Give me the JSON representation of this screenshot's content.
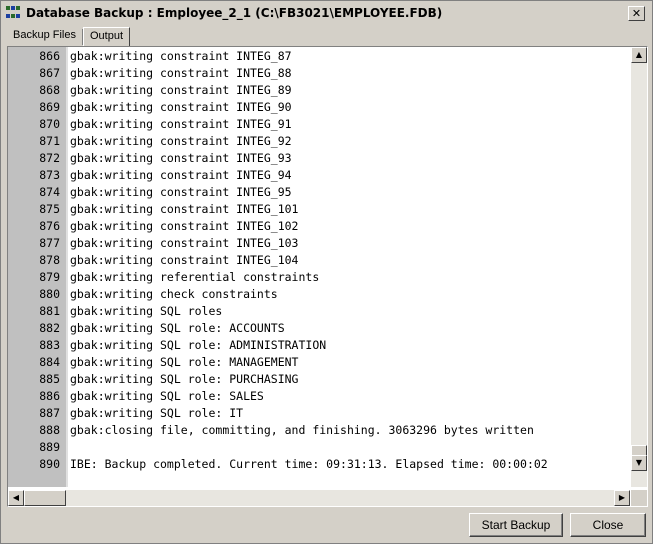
{
  "window": {
    "title": "Database Backup : Employee_2_1 (C:\\FB3021\\EMPLOYEE.FDB)",
    "close_glyph": "✕"
  },
  "tabs": [
    {
      "label": "Backup Files",
      "active": false
    },
    {
      "label": "Output",
      "active": true
    }
  ],
  "output": {
    "lines": [
      {
        "num": "866",
        "text": "gbak:writing constraint INTEG_87"
      },
      {
        "num": "867",
        "text": "gbak:writing constraint INTEG_88"
      },
      {
        "num": "868",
        "text": "gbak:writing constraint INTEG_89"
      },
      {
        "num": "869",
        "text": "gbak:writing constraint INTEG_90"
      },
      {
        "num": "870",
        "text": "gbak:writing constraint INTEG_91"
      },
      {
        "num": "871",
        "text": "gbak:writing constraint INTEG_92"
      },
      {
        "num": "872",
        "text": "gbak:writing constraint INTEG_93"
      },
      {
        "num": "873",
        "text": "gbak:writing constraint INTEG_94"
      },
      {
        "num": "874",
        "text": "gbak:writing constraint INTEG_95"
      },
      {
        "num": "875",
        "text": "gbak:writing constraint INTEG_101"
      },
      {
        "num": "876",
        "text": "gbak:writing constraint INTEG_102"
      },
      {
        "num": "877",
        "text": "gbak:writing constraint INTEG_103"
      },
      {
        "num": "878",
        "text": "gbak:writing constraint INTEG_104"
      },
      {
        "num": "879",
        "text": "gbak:writing referential constraints"
      },
      {
        "num": "880",
        "text": "gbak:writing check constraints"
      },
      {
        "num": "881",
        "text": "gbak:writing SQL roles"
      },
      {
        "num": "882",
        "text": "gbak:writing SQL role: ACCOUNTS"
      },
      {
        "num": "883",
        "text": "gbak:writing SQL role: ADMINISTRATION"
      },
      {
        "num": "884",
        "text": "gbak:writing SQL role: MANAGEMENT"
      },
      {
        "num": "885",
        "text": "gbak:writing SQL role: PURCHASING"
      },
      {
        "num": "886",
        "text": "gbak:writing SQL role: SALES"
      },
      {
        "num": "887",
        "text": "gbak:writing SQL role: IT"
      },
      {
        "num": "888",
        "text": "gbak:closing file, committing, and finishing. 3063296 bytes written"
      },
      {
        "num": "889",
        "text": ""
      },
      {
        "num": "890",
        "text": "IBE: Backup completed. Current time: 09:31:13. Elapsed time: 00:00:02"
      }
    ]
  },
  "buttons": {
    "start_backup": "Start Backup",
    "close": "Close"
  },
  "icons": {
    "window_icon": "database-backup-icon",
    "scroll_up": "▲",
    "scroll_down": "▼",
    "scroll_left": "◀",
    "scroll_right": "▶"
  },
  "colors": {
    "window_bg": "#d4d0c8",
    "gutter_bg": "#c0c0c0",
    "editor_bg": "#ffffff"
  }
}
